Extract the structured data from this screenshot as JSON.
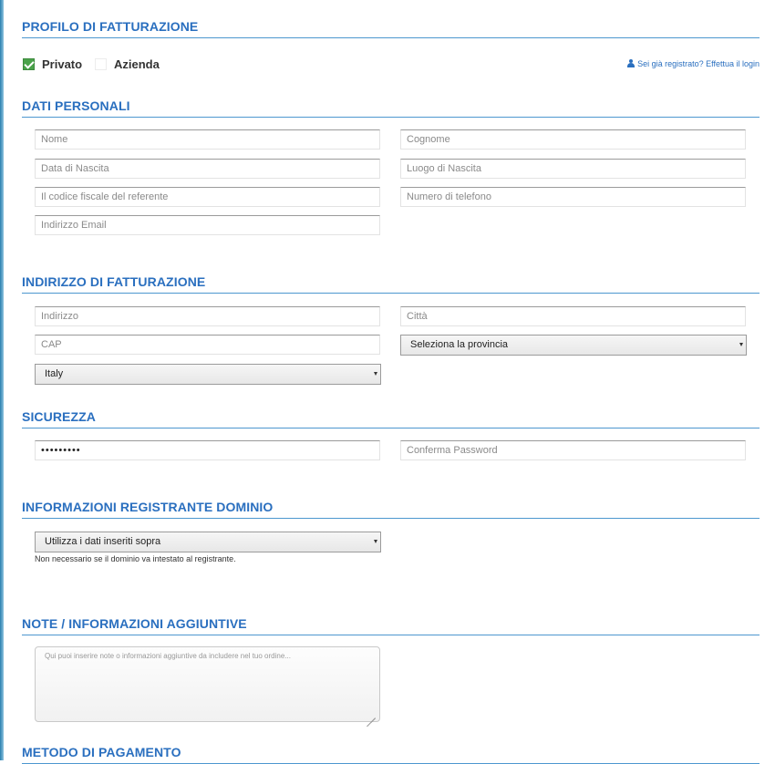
{
  "sections": {
    "billing_profile": "PROFILO DI FATTURAZIONE",
    "personal_data": "DATI PERSONALI",
    "billing_address": "INDIRIZZO DI FATTURAZIONE",
    "security": "SICUREZZA",
    "domain_registrant": "INFORMAZIONI REGISTRANTE DOMINIO",
    "notes": "NOTE / INFORMAZIONI AGGIUNTIVE",
    "payment": "METODO DI PAGAMENTO"
  },
  "profile": {
    "private_label": "Privato",
    "private_checked": true,
    "company_label": "Azienda",
    "company_checked": false,
    "login_link": "Sei già registrato? Effettua il login"
  },
  "personal": {
    "first_name": "Nome",
    "last_name": "Cognome",
    "birth_date": "Data di Nascita",
    "birth_place": "Luogo di Nascita",
    "tax_code": "Il codice fiscale del referente",
    "phone": "Numero di telefono",
    "email": "Indirizzo Email"
  },
  "address": {
    "street": "Indirizzo",
    "city": "Città",
    "zip": "CAP",
    "province": "Seleziona la provincia",
    "country": "Italy"
  },
  "security": {
    "password_value": "•••••••••",
    "confirm_password": "Conferma Password"
  },
  "registrant": {
    "selected": "Utilizza i dati inseriti sopra",
    "help": "Non necessario se il dominio va intestato al registrante."
  },
  "notes": {
    "placeholder": "Qui puoi inserire note o informazioni aggiuntive da includere nel tuo ordine..."
  },
  "colors": {
    "accent": "#2a6fbf",
    "check_green": "#4aa24a"
  }
}
